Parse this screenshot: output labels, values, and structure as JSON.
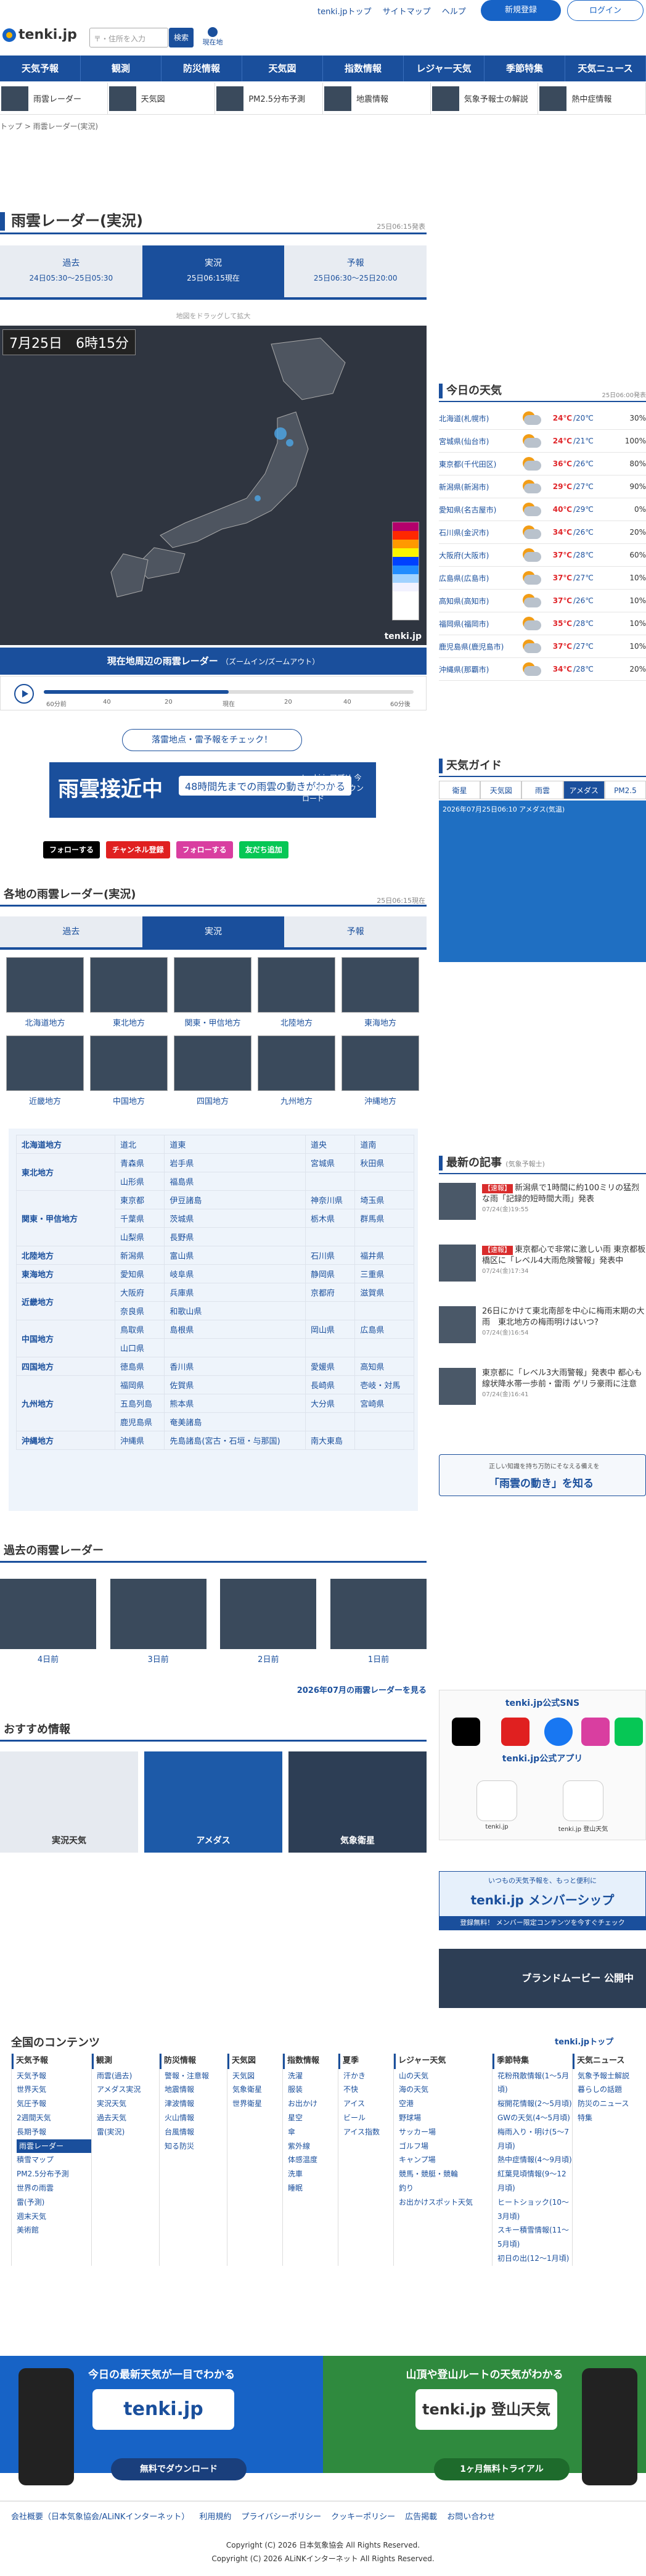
{
  "header": {
    "logo": "tenki.jp",
    "search_placeholder": "〒・住所を入力",
    "search_btn": "検索",
    "location_btn": "現在地",
    "links": [
      "tenki.jpトップ",
      "サイトマップ",
      "ヘルプ"
    ],
    "register": "新規登録",
    "login": "ログイン"
  },
  "nav": [
    "天気予報",
    "観測",
    "防災情報",
    "天気図",
    "指数情報",
    "レジャー天気",
    "季節特集",
    "天気ニュース"
  ],
  "subnav": [
    "雨雲レーダー",
    "天気図",
    "PM2.5分布予測",
    "地震情報",
    "気象予報士の解説",
    "熱中症情報"
  ],
  "breadcrumb": "トップ > 雨雲レーダー(実況)",
  "main": {
    "title": "雨雲レーダー(実況)",
    "updated": "25日06:15発表",
    "tabs": [
      {
        "label": "過去",
        "sub": "24日05:30〜25日05:30"
      },
      {
        "label": "実況",
        "sub": "25日06:15現在"
      },
      {
        "label": "予報",
        "sub": "25日06:30〜25日20:00"
      }
    ],
    "drag_hint": "地図をドラッグして拡大",
    "radar_date": "7月25日　6時15分",
    "radar_watermark": "tenki.jp",
    "current_bar": "現在地周辺の雨雲レーダー",
    "current_bar_sub": "（ズームイン/ズームアウト）",
    "timeline": {
      "labels": [
        "60分前",
        "40",
        "20",
        "現在",
        "20",
        "40",
        "60分後"
      ],
      "progress": 0.5
    },
    "lightning_btn": "落雷地点・雷予報をチェック！",
    "banner": {
      "headline": "雨雲接近中",
      "mid": "48時間先までの雨雲の動きがわかる",
      "right": "tenki.jpアプリ 今すぐ無料で ダウンロード"
    },
    "sns": [
      {
        "label": "フォローする",
        "color": "#000000"
      },
      {
        "label": "チャンネル登録",
        "color": "#e02020"
      },
      {
        "label": "フォローする",
        "color": "#d93ea0"
      },
      {
        "label": "友だち追加",
        "color": "#06c755"
      }
    ]
  },
  "regions_section": {
    "title": "各地の雨雲レーダー(実況)",
    "updated": "25日06:15現在",
    "tabs": [
      "過去",
      "実況",
      "予報"
    ],
    "regions": [
      "北海道地方",
      "東北地方",
      "関東・甲信地方",
      "北陸地方",
      "東海地方",
      "近畿地方",
      "中国地方",
      "四国地方",
      "九州地方",
      "沖縄地方"
    ],
    "table": [
      {
        "region": "北海道地方",
        "prefs": [
          "道北",
          "道東",
          "道央",
          "道南"
        ]
      },
      {
        "region": "東北地方",
        "prefs": [
          "青森県",
          "岩手県",
          "宮城県",
          "秋田県",
          "山形県",
          "福島県"
        ]
      },
      {
        "region": "関東・甲信地方",
        "prefs": [
          "東京都",
          "伊豆諸島",
          "神奈川県",
          "埼玉県",
          "千葉県",
          "茨城県",
          "栃木県",
          "群馬県",
          "山梨県",
          "長野県"
        ]
      },
      {
        "region": "北陸地方",
        "prefs": [
          "新潟県",
          "富山県",
          "石川県",
          "福井県"
        ]
      },
      {
        "region": "東海地方",
        "prefs": [
          "愛知県",
          "岐阜県",
          "静岡県",
          "三重県"
        ]
      },
      {
        "region": "近畿地方",
        "prefs": [
          "大阪府",
          "兵庫県",
          "京都府",
          "滋賀県",
          "奈良県",
          "和歌山県"
        ]
      },
      {
        "region": "中国地方",
        "prefs": [
          "鳥取県",
          "島根県",
          "岡山県",
          "広島県",
          "山口県"
        ]
      },
      {
        "region": "四国地方",
        "prefs": [
          "徳島県",
          "香川県",
          "愛媛県",
          "高知県"
        ]
      },
      {
        "region": "九州地方",
        "prefs": [
          "福岡県",
          "佐賀県",
          "長崎県",
          "壱岐・対馬",
          "五島列島",
          "熊本県",
          "大分県",
          "宮崎県",
          "鹿児島県",
          "奄美諸島"
        ]
      },
      {
        "region": "沖縄地方",
        "prefs": [
          "沖縄県",
          "先島諸島(宮古・石垣・与那国)",
          "南大東島"
        ]
      }
    ]
  },
  "past": {
    "title": "過去の雨雲レーダー",
    "days": [
      "4日前",
      "3日前",
      "2日前",
      "1日前"
    ],
    "more": "2026年07月の雨雲レーダーを見る"
  },
  "recommend": {
    "title": "おすすめ情報",
    "items": [
      "実況天気",
      "アメダス",
      "気象衛星"
    ]
  },
  "sidebar": {
    "today_title": "今日の天気",
    "today_updated": "25日06:00発表",
    "weather": [
      {
        "city": "北海道(札幌市)",
        "hi": "24℃",
        "lo": "20℃",
        "pop": "30%"
      },
      {
        "city": "宮城県(仙台市)",
        "hi": "24℃",
        "lo": "21℃",
        "pop": "100%"
      },
      {
        "city": "東京都(千代田区)",
        "hi": "36℃",
        "lo": "26℃",
        "pop": "80%"
      },
      {
        "city": "新潟県(新潟市)",
        "hi": "29℃",
        "lo": "27℃",
        "pop": "90%"
      },
      {
        "city": "愛知県(名古屋市)",
        "hi": "40℃",
        "lo": "29℃",
        "pop": "0%"
      },
      {
        "city": "石川県(金沢市)",
        "hi": "34℃",
        "lo": "26℃",
        "pop": "20%"
      },
      {
        "city": "大阪府(大阪市)",
        "hi": "37℃",
        "lo": "28℃",
        "pop": "60%"
      },
      {
        "city": "広島県(広島市)",
        "hi": "37℃",
        "lo": "27℃",
        "pop": "10%"
      },
      {
        "city": "高知県(高知市)",
        "hi": "37℃",
        "lo": "26℃",
        "pop": "10%"
      },
      {
        "city": "福岡県(福岡市)",
        "hi": "35℃",
        "lo": "28℃",
        "pop": "10%"
      },
      {
        "city": "鹿児島県(鹿児島市)",
        "hi": "37℃",
        "lo": "27℃",
        "pop": "10%"
      },
      {
        "city": "沖縄県(那覇市)",
        "hi": "34℃",
        "lo": "28℃",
        "pop": "20%"
      }
    ],
    "guide_title": "天気ガイド",
    "guide_tabs": [
      "衛星",
      "天気図",
      "雨雲",
      "アメダス",
      "PM2.5"
    ],
    "guide_caption": "2026年07月25日06:10 アメダス(気温)",
    "articles_title": "最新の記事",
    "articles_sub": "(気象予報士)",
    "articles": [
      {
        "tag": "【速報】",
        "text": "新潟県で1時間に約100ミリの猛烈な雨「記録的短時間大雨」発表",
        "time": "07/24(金)19:55"
      },
      {
        "tag": "【速報】",
        "text": "東京都心で非常に激しい雨 東京都板橋区に「レベル4大雨危険警報」発表中",
        "time": "07/24(金)17:34"
      },
      {
        "tag": "",
        "text": "26日にかけて東北南部を中心に梅雨末期の大雨　東北地方の梅雨明けはいつ?",
        "time": "07/24(金)16:54"
      },
      {
        "tag": "",
        "text": "東京都に「レベル3大雨警報」発表中 都心も線状降水帯一歩前・雷雨 ゲリラ豪雨に注意",
        "time": "07/24(金)16:41"
      }
    ],
    "know_small": "正しい知識を持ち万防にそなえる備えを",
    "know_title": "「雨雲の動き」を知る",
    "sns_title": "tenki.jp公式SNS",
    "app_title": "tenki.jp公式アプリ",
    "apps": [
      "tenki.jp",
      "tenki.jp 登山天気"
    ],
    "member_small": "いつもの天気予報を、もっと便利に",
    "member_title": "tenki.jp メンバーシップ",
    "member_bar": "登録無料！ メンバー限定コンテンツを今すぐチェック",
    "brand": "ブランドムービー 公開中"
  },
  "contents": {
    "title": "全国のコンテンツ",
    "top_link": "tenki.jpトップ",
    "cols": [
      {
        "head": "天気予報",
        "items": [
          "天気予報",
          "世界天気",
          "気圧予報",
          "2週間天気",
          "長期予報",
          "雨雲レーダー",
          "積雪マップ",
          "PM2.5分布予測",
          "世界の雨雲",
          "雷(予測)",
          "週末天気",
          "美術館"
        ]
      },
      {
        "head": "観測",
        "items": [
          "雨雲(過去)",
          "アメダス実況",
          "実況天気",
          "過去天気",
          "雷(実況)"
        ]
      },
      {
        "head": "防災情報",
        "items": [
          "警報・注意報",
          "地震情報",
          "津波情報",
          "火山情報",
          "台風情報",
          "知る防災"
        ]
      },
      {
        "head": "天気図",
        "items": [
          "天気図",
          "気象衛星",
          "世界衛星"
        ]
      },
      {
        "head": "指数情報",
        "items": [
          "洗濯",
          "服装",
          "お出かけ",
          "星空",
          "傘",
          "紫外線",
          "体感温度",
          "洗車",
          "睡眠"
        ]
      },
      {
        "head": "夏季",
        "items": [
          "汗かき",
          "不快",
          "アイス",
          "ビール",
          "アイス指数"
        ]
      },
      {
        "head": "レジャー天気",
        "items": [
          "山の天気",
          "海の天気",
          "空港",
          "野球場",
          "サッカー場",
          "ゴルフ場",
          "キャンプ場",
          "競馬・競艇・競輪",
          "釣り",
          "お出かけスポット天気"
        ]
      },
      {
        "head": "季節特集",
        "items": [
          "花粉飛散情報(1〜5月頃)",
          "桜開花情報(2〜5月頃)",
          "GWの天気(4〜5月頃)",
          "梅雨入り・明け(5〜7月頃)",
          "熱中症情報(4〜9月頃)",
          "紅葉見頃情報(9〜12月頃)",
          "ヒートショック(10〜3月頃)",
          "スキー積雪情報(11〜5月頃)",
          "初日の出(12〜1月頃)"
        ]
      },
      {
        "head": "天気ニュース",
        "items": [
          "気象予報士解説",
          "暮らしの話題",
          "防災のニュース",
          "特集"
        ]
      }
    ]
  },
  "app_banners": [
    {
      "title": "今日の最新天気が一目でわかる",
      "brand": "tenki.jp",
      "btn": "無料でダウンロード"
    },
    {
      "title": "山頂や登山ルートの天気がわかる",
      "brand": "tenki.jp 登山天気",
      "btn": "1ヶ月無料トライアル"
    }
  ],
  "footer": {
    "links": [
      "会社概要（日本気象協会/ALiNKインターネット）",
      "利用規約",
      "プライバシーポリシー",
      "クッキーポリシー",
      "広告掲載",
      "お問い合わせ"
    ],
    "copy1": "Copyright (C) 2026 日本気象協会 All Rights Reserved.",
    "copy2": "Copyright (C) 2026 ALiNKインターネット All Rights Reserved."
  }
}
